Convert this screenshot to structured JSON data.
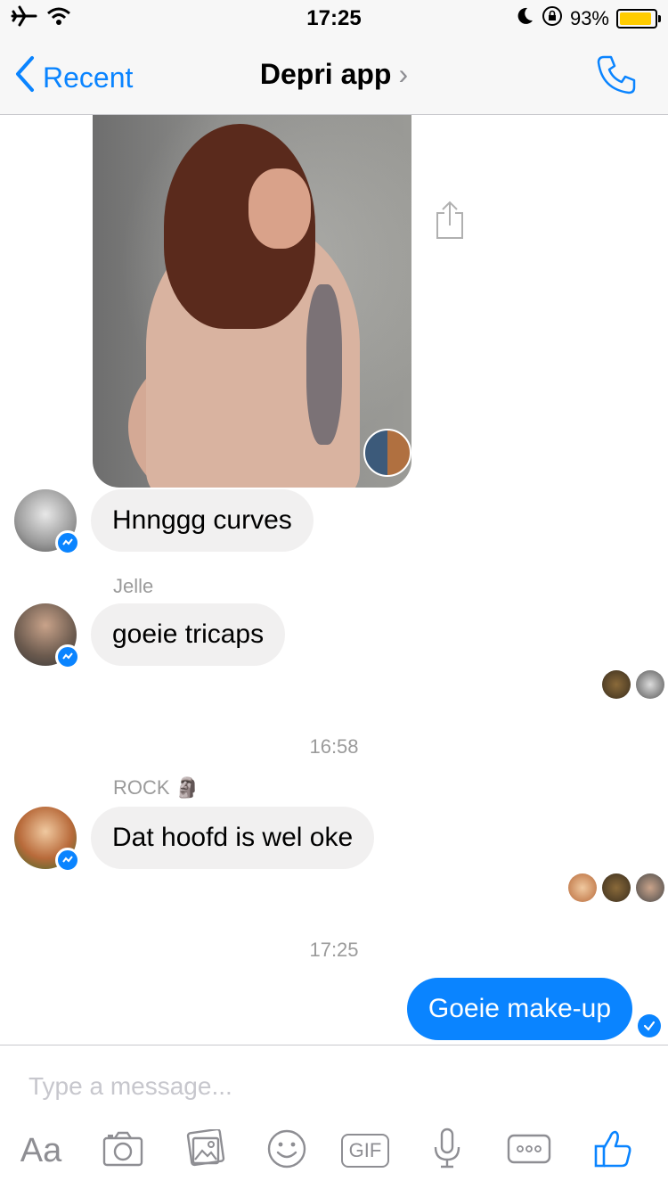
{
  "status_bar": {
    "time": "17:25",
    "battery_percent": "93%",
    "battery_level": 0.93,
    "icons": [
      "airplane-icon",
      "wifi-icon",
      "moon-icon",
      "rotation-lock-icon",
      "battery-icon"
    ]
  },
  "nav": {
    "back_label": "Recent",
    "title": "Depri app",
    "title_chevron": "›",
    "accent_color": "#0a84ff"
  },
  "messages": {
    "m1_text": "Hnnggg curves",
    "m2_sender": "Jelle",
    "m2_text": "goeie tricaps",
    "ts1": "16:58",
    "m3_sender": "ROCK",
    "m3_emoji": "🗿",
    "m3_text": "Dat hoofd is wel oke",
    "ts2": "17:25",
    "m4_text": "Goeie make-up"
  },
  "composer": {
    "placeholder": "Type a message...",
    "aa_label": "Aa",
    "gif_label": "GIF",
    "tools": [
      "camera-icon",
      "photo-gallery-icon",
      "emoji-icon",
      "gif-icon",
      "microphone-icon",
      "more-icon",
      "thumbs-up-icon"
    ]
  },
  "colors": {
    "outgoing_bubble": "#0a84ff",
    "incoming_bubble": "#f1f0f0",
    "meta_text": "#9b9b9b"
  }
}
